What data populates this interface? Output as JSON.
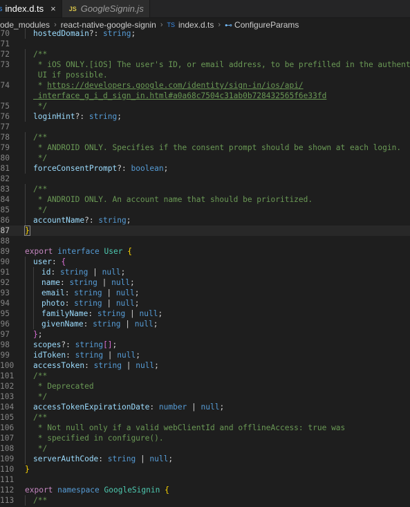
{
  "tabs": [
    {
      "name": "index.d.ts",
      "active": true
    },
    {
      "name": "GoogleSignin.js",
      "active": false
    }
  ],
  "breadcrumb": [
    "ode_modules",
    "react-native-google-signin",
    "index.d.ts",
    "ConfigureParams"
  ],
  "lines": [
    {
      "n": "70",
      "segs": [
        [
          "prop",
          "hostedDomain"
        ],
        [
          "pn",
          "?: "
        ],
        [
          "kw",
          "string"
        ],
        [
          "pn",
          ";"
        ]
      ],
      "indent": 1
    },
    {
      "n": "71",
      "segs": [],
      "indent": 0
    },
    {
      "n": "72",
      "segs": [
        [
          "cm",
          "/**"
        ]
      ],
      "indent": 1
    },
    {
      "n": "73",
      "segs": [
        [
          "cm",
          " * iOS ONLY.[iOS] The user's ID, or email address, to be prefilled in the authentication"
        ]
      ],
      "indent": 1
    },
    {
      "n": "",
      "segs": [
        [
          "cm",
          " UI if possible."
        ]
      ],
      "indent": 1
    },
    {
      "n": "74",
      "segs": [
        [
          "cm",
          " * "
        ],
        [
          "lnk",
          "https://developers.google.com/identity/sign-in/ios/api/"
        ]
      ],
      "indent": 1
    },
    {
      "n": "",
      "segs": [
        [
          "lnk",
          " interface_g_i_d_sign_in.html#a0a68c7504c31ab0b728432565f6e33fd"
        ]
      ],
      "indent": 1
    },
    {
      "n": "75",
      "segs": [
        [
          "cm",
          " */"
        ]
      ],
      "indent": 1
    },
    {
      "n": "76",
      "segs": [
        [
          "prop",
          "loginHint"
        ],
        [
          "pn",
          "?: "
        ],
        [
          "kw",
          "string"
        ],
        [
          "pn",
          ";"
        ]
      ],
      "indent": 1
    },
    {
      "n": "77",
      "segs": [],
      "indent": 0
    },
    {
      "n": "78",
      "segs": [
        [
          "cm",
          "/**"
        ]
      ],
      "indent": 1
    },
    {
      "n": "79",
      "segs": [
        [
          "cm",
          " * ANDROID ONLY. Specifies if the consent prompt should be shown at each login."
        ]
      ],
      "indent": 1
    },
    {
      "n": "80",
      "segs": [
        [
          "cm",
          " */"
        ]
      ],
      "indent": 1
    },
    {
      "n": "81",
      "segs": [
        [
          "prop",
          "forceConsentPrompt"
        ],
        [
          "pn",
          "?: "
        ],
        [
          "kw",
          "boolean"
        ],
        [
          "pn",
          ";"
        ]
      ],
      "indent": 1
    },
    {
      "n": "82",
      "segs": [],
      "indent": 0
    },
    {
      "n": "83",
      "segs": [
        [
          "cm",
          "/**"
        ]
      ],
      "indent": 1
    },
    {
      "n": "84",
      "segs": [
        [
          "cm",
          " * ANDROID ONLY. An account name that should be prioritized."
        ]
      ],
      "indent": 1
    },
    {
      "n": "85",
      "segs": [
        [
          "cm",
          " */"
        ]
      ],
      "indent": 1
    },
    {
      "n": "86",
      "segs": [
        [
          "prop",
          "accountName"
        ],
        [
          "pn",
          "?: "
        ],
        [
          "kw",
          "string"
        ],
        [
          "pn",
          ";"
        ]
      ],
      "indent": 1
    },
    {
      "n": "87",
      "segs": [
        [
          "br",
          "}"
        ]
      ],
      "indent": 0,
      "current": true
    },
    {
      "n": "88",
      "segs": [],
      "indent": 0
    },
    {
      "n": "89",
      "segs": [
        [
          "kwc",
          "export "
        ],
        [
          "kw",
          "interface "
        ],
        [
          "ty",
          "User "
        ],
        [
          "br",
          "{"
        ]
      ],
      "indent": 0
    },
    {
      "n": "90",
      "segs": [
        [
          "prop",
          "user"
        ],
        [
          "pn",
          ": "
        ],
        [
          "br2",
          "{"
        ]
      ],
      "indent": 1
    },
    {
      "n": "91",
      "segs": [
        [
          "prop",
          "id"
        ],
        [
          "pn",
          ": "
        ],
        [
          "kw",
          "string"
        ],
        [
          "pn",
          " | "
        ],
        [
          "kw",
          "null"
        ],
        [
          "pn",
          ";"
        ]
      ],
      "indent": 2
    },
    {
      "n": "92",
      "segs": [
        [
          "prop",
          "name"
        ],
        [
          "pn",
          ": "
        ],
        [
          "kw",
          "string"
        ],
        [
          "pn",
          " | "
        ],
        [
          "kw",
          "null"
        ],
        [
          "pn",
          ";"
        ]
      ],
      "indent": 2
    },
    {
      "n": "93",
      "segs": [
        [
          "prop",
          "email"
        ],
        [
          "pn",
          ": "
        ],
        [
          "kw",
          "string"
        ],
        [
          "pn",
          " | "
        ],
        [
          "kw",
          "null"
        ],
        [
          "pn",
          ";"
        ]
      ],
      "indent": 2
    },
    {
      "n": "94",
      "segs": [
        [
          "prop",
          "photo"
        ],
        [
          "pn",
          ": "
        ],
        [
          "kw",
          "string"
        ],
        [
          "pn",
          " | "
        ],
        [
          "kw",
          "null"
        ],
        [
          "pn",
          ";"
        ]
      ],
      "indent": 2
    },
    {
      "n": "95",
      "segs": [
        [
          "prop",
          "familyName"
        ],
        [
          "pn",
          ": "
        ],
        [
          "kw",
          "string"
        ],
        [
          "pn",
          " | "
        ],
        [
          "kw",
          "null"
        ],
        [
          "pn",
          ";"
        ]
      ],
      "indent": 2
    },
    {
      "n": "96",
      "segs": [
        [
          "prop",
          "givenName"
        ],
        [
          "pn",
          ": "
        ],
        [
          "kw",
          "string"
        ],
        [
          "pn",
          " | "
        ],
        [
          "kw",
          "null"
        ],
        [
          "pn",
          ";"
        ]
      ],
      "indent": 2
    },
    {
      "n": "97",
      "segs": [
        [
          "br2",
          "}"
        ],
        [
          "pn",
          ";"
        ]
      ],
      "indent": 1
    },
    {
      "n": "98",
      "segs": [
        [
          "prop",
          "scopes"
        ],
        [
          "pn",
          "?: "
        ],
        [
          "kw",
          "string"
        ],
        [
          "br2",
          "[]"
        ],
        [
          "pn",
          ";"
        ]
      ],
      "indent": 1
    },
    {
      "n": "99",
      "segs": [
        [
          "prop",
          "idToken"
        ],
        [
          "pn",
          ": "
        ],
        [
          "kw",
          "string"
        ],
        [
          "pn",
          " | "
        ],
        [
          "kw",
          "null"
        ],
        [
          "pn",
          ";"
        ]
      ],
      "indent": 1
    },
    {
      "n": "100",
      "segs": [
        [
          "prop",
          "accessToken"
        ],
        [
          "pn",
          ": "
        ],
        [
          "kw",
          "string"
        ],
        [
          "pn",
          " | "
        ],
        [
          "kw",
          "null"
        ],
        [
          "pn",
          ";"
        ]
      ],
      "indent": 1
    },
    {
      "n": "101",
      "segs": [
        [
          "cm",
          "/**"
        ]
      ],
      "indent": 1
    },
    {
      "n": "102",
      "segs": [
        [
          "cm",
          " * Deprecated"
        ]
      ],
      "indent": 1
    },
    {
      "n": "103",
      "segs": [
        [
          "cm",
          " */"
        ]
      ],
      "indent": 1
    },
    {
      "n": "104",
      "segs": [
        [
          "prop",
          "accessTokenExpirationDate"
        ],
        [
          "pn",
          ": "
        ],
        [
          "kw",
          "number"
        ],
        [
          "pn",
          " | "
        ],
        [
          "kw",
          "null"
        ],
        [
          "pn",
          ";"
        ]
      ],
      "indent": 1
    },
    {
      "n": "105",
      "segs": [
        [
          "cm",
          "/**"
        ]
      ],
      "indent": 1
    },
    {
      "n": "106",
      "segs": [
        [
          "cm",
          " * Not null only if a valid webClientId and offlineAccess: true was"
        ]
      ],
      "indent": 1
    },
    {
      "n": "107",
      "segs": [
        [
          "cm",
          " * specified in configure()."
        ]
      ],
      "indent": 1
    },
    {
      "n": "108",
      "segs": [
        [
          "cm",
          " */"
        ]
      ],
      "indent": 1
    },
    {
      "n": "109",
      "segs": [
        [
          "prop",
          "serverAuthCode"
        ],
        [
          "pn",
          ": "
        ],
        [
          "kw",
          "string"
        ],
        [
          "pn",
          " | "
        ],
        [
          "kw",
          "null"
        ],
        [
          "pn",
          ";"
        ]
      ],
      "indent": 1
    },
    {
      "n": "110",
      "segs": [
        [
          "br",
          "}"
        ]
      ],
      "indent": 0
    },
    {
      "n": "111",
      "segs": [],
      "indent": 0
    },
    {
      "n": "112",
      "segs": [
        [
          "kwc",
          "export "
        ],
        [
          "kw",
          "namespace "
        ],
        [
          "ty",
          "GoogleSignin "
        ],
        [
          "br",
          "{"
        ]
      ],
      "indent": 0
    },
    {
      "n": "113",
      "segs": [
        [
          "cm",
          "/**"
        ]
      ],
      "indent": 1
    }
  ]
}
